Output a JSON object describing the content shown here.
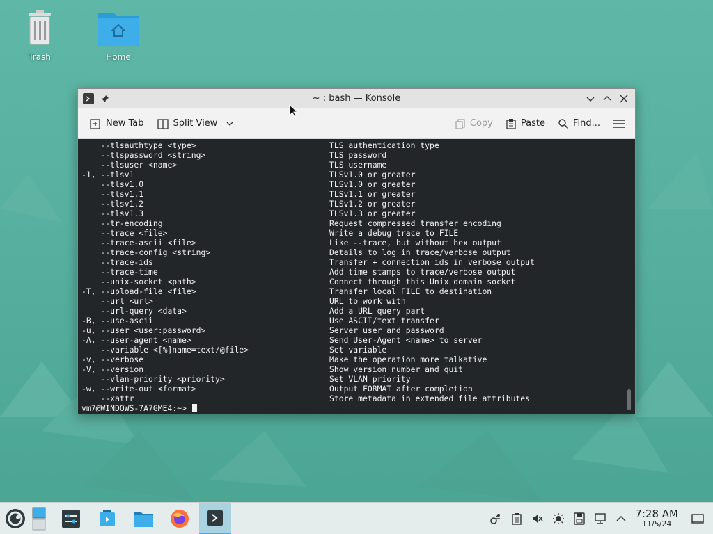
{
  "desktop": {
    "icons": [
      {
        "label": "Trash"
      },
      {
        "label": "Home"
      }
    ]
  },
  "window": {
    "title": "~ : bash — Konsole",
    "toolbar": {
      "new_tab": "New Tab",
      "split_view": "Split View",
      "copy": "Copy",
      "paste": "Paste",
      "find": "Find..."
    }
  },
  "terminal": {
    "lines": [
      {
        "opt": "    --tlsauthtype <type>",
        "desc": "TLS authentication type"
      },
      {
        "opt": "    --tlspassword <string>",
        "desc": "TLS password"
      },
      {
        "opt": "    --tlsuser <name>",
        "desc": "TLS username"
      },
      {
        "opt": "-1, --tlsv1",
        "desc": "TLSv1.0 or greater"
      },
      {
        "opt": "    --tlsv1.0",
        "desc": "TLSv1.0 or greater"
      },
      {
        "opt": "    --tlsv1.1",
        "desc": "TLSv1.1 or greater"
      },
      {
        "opt": "    --tlsv1.2",
        "desc": "TLSv1.2 or greater"
      },
      {
        "opt": "    --tlsv1.3",
        "desc": "TLSv1.3 or greater"
      },
      {
        "opt": "    --tr-encoding",
        "desc": "Request compressed transfer encoding"
      },
      {
        "opt": "    --trace <file>",
        "desc": "Write a debug trace to FILE"
      },
      {
        "opt": "    --trace-ascii <file>",
        "desc": "Like --trace, but without hex output"
      },
      {
        "opt": "    --trace-config <string>",
        "desc": "Details to log in trace/verbose output"
      },
      {
        "opt": "    --trace-ids",
        "desc": "Transfer + connection ids in verbose output"
      },
      {
        "opt": "    --trace-time",
        "desc": "Add time stamps to trace/verbose output"
      },
      {
        "opt": "    --unix-socket <path>",
        "desc": "Connect through this Unix domain socket"
      },
      {
        "opt": "-T, --upload-file <file>",
        "desc": "Transfer local FILE to destination"
      },
      {
        "opt": "    --url <url>",
        "desc": "URL to work with"
      },
      {
        "opt": "    --url-query <data>",
        "desc": "Add a URL query part"
      },
      {
        "opt": "-B, --use-ascii",
        "desc": "Use ASCII/text transfer"
      },
      {
        "opt": "-u, --user <user:password>",
        "desc": "Server user and password"
      },
      {
        "opt": "-A, --user-agent <name>",
        "desc": "Send User-Agent <name> to server"
      },
      {
        "opt": "    --variable <[%]name=text/@file>",
        "desc": "Set variable"
      },
      {
        "opt": "-v, --verbose",
        "desc": "Make the operation more talkative"
      },
      {
        "opt": "-V, --version",
        "desc": "Show version number and quit"
      },
      {
        "opt": "    --vlan-priority <priority>",
        "desc": "Set VLAN priority"
      },
      {
        "opt": "-w, --write-out <format>",
        "desc": "Output FORMAT after completion"
      },
      {
        "opt": "    --xattr",
        "desc": "Store metadata in extended file attributes"
      }
    ],
    "prompt": "vm7@WINDOWS-7A7GME4:~> "
  },
  "taskbar": {
    "time": "7:28 AM",
    "date": "11/5/24"
  },
  "colors": {
    "accent": "#3daee9",
    "terminal_bg": "#232629",
    "desktop_bg": "#5fb7a7"
  }
}
